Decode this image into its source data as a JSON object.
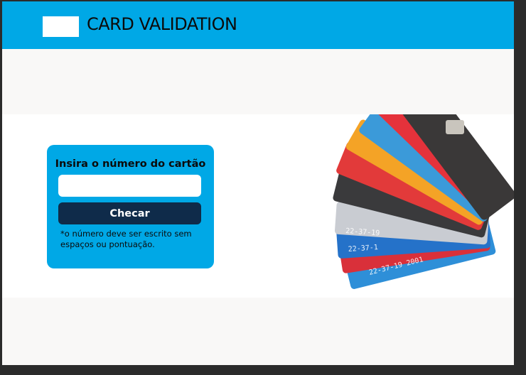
{
  "header": {
    "brand_title": "CARD VALIDATION"
  },
  "form": {
    "title": "Insira o número do cartão",
    "input_value": "",
    "input_placeholder": "",
    "check_button_label": "Checar",
    "hint": "*o número deve ser escrito sem espaços ou pontuação."
  },
  "hero_image": {
    "icon": "credit-cards-fan-image",
    "card_numbers": [
      "22-37-19",
      "22-37-1",
      "22-37-19 2001"
    ]
  },
  "colors": {
    "header_bg": "#00a8e6",
    "form_bg": "#00a8e6",
    "button_bg": "#0f2b4a",
    "page_bg": "#f9f8f7"
  }
}
